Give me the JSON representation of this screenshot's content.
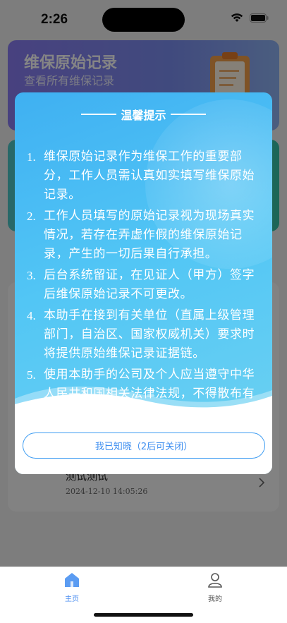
{
  "status_bar": {
    "time": "2:26"
  },
  "background": {
    "records_card": {
      "title": "维保原始记录",
      "subtitle": "查看所有维保记录"
    },
    "list_item": {
      "title": "测试测试",
      "date": "2024-12-10 14:05:26"
    }
  },
  "modal": {
    "title": "温馨提示",
    "items": [
      {
        "num": "1.",
        "text": "维保原始记录作为维保工作的重要部分，工作人员需认真如实填写维保原始记录。"
      },
      {
        "num": "2.",
        "text": "工作人员填写的原始记录视为现场真实情况，若存在弄虚作假的维保原始记录，产生的一切后果自行承担。"
      },
      {
        "num": "3.",
        "text": "后台系统留证，在见证人（甲方）签字后维保原始记录不可更改。"
      },
      {
        "num": "4.",
        "text": "本助手在接到有关单位（直属上级管理部门，自治区、国家权威机关）要求时将提供原始维保记录证据链。"
      },
      {
        "num": "5.",
        "text": "使用本助手的公司及个人应当遵守中华人民共和国相关法律法规，不得散布有损或有害国家的谣言。"
      }
    ],
    "ack_button": "我已知晓（2后可关闭）"
  },
  "tabbar": {
    "tabs": [
      {
        "label": "主页",
        "icon": "home-icon",
        "active": true
      },
      {
        "label": "我的",
        "icon": "user-icon",
        "active": false
      }
    ]
  },
  "colors": {
    "accent": "#4a8df0",
    "modal_gradient_start": "#3fb0f2",
    "modal_gradient_end": "#6fd2f1"
  }
}
